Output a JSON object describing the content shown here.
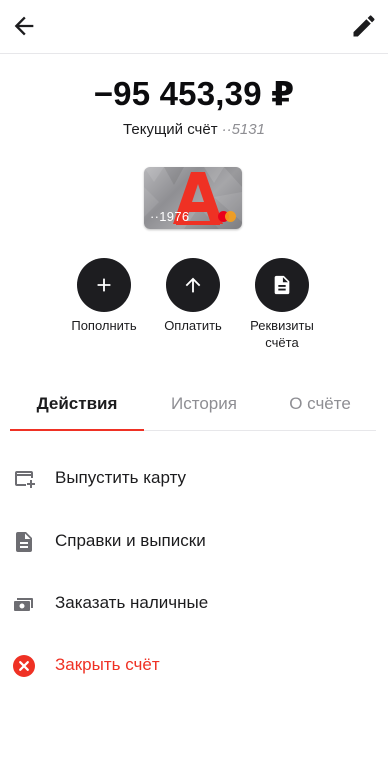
{
  "header": {
    "back_icon": "arrow-left-icon",
    "edit_icon": "pencil-icon"
  },
  "account": {
    "balance": "−95 453,39 ₽",
    "name": "Текущий счёт",
    "number_mask": "··5131"
  },
  "card": {
    "number_tail": "··1976",
    "payment_system_icon": "mastercard-icon",
    "brand_color": "#ef3124"
  },
  "quick_actions": [
    {
      "label": "Пополнить",
      "icon": "plus-icon"
    },
    {
      "label": "Оплатить",
      "icon": "arrow-up-icon"
    },
    {
      "label": "Реквизиты\nсчёта",
      "line1": "Реквизиты",
      "line2": "счёта",
      "icon": "document-icon"
    }
  ],
  "tabs": [
    {
      "label": "Действия",
      "active": true
    },
    {
      "label": "История",
      "active": false
    },
    {
      "label": "О счёте",
      "active": false
    }
  ],
  "menu": [
    {
      "label": "Выпустить карту",
      "icon": "card-add-icon"
    },
    {
      "label": "Справки и выписки",
      "icon": "document-icon"
    },
    {
      "label": "Заказать наличные",
      "icon": "cash-icon"
    },
    {
      "label": "Закрыть счёт",
      "icon": "close-circle-icon",
      "color": "#ef3124"
    }
  ],
  "colors": {
    "accent": "#ef3124",
    "dark": "#1d1d20",
    "muted": "#8e8e93"
  }
}
